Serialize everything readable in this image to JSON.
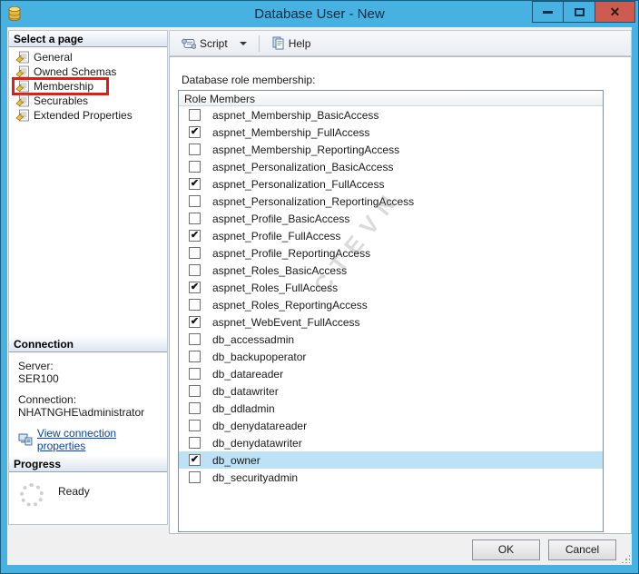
{
  "window": {
    "title": "Database User - New"
  },
  "icons": {
    "titlebar": "database-cylinder-icon",
    "close_glyph": "✕",
    "checkmark_glyph": "✔"
  },
  "sidebar": {
    "select_page_header": "Select a page",
    "pages": [
      {
        "label": "General",
        "annotated": false
      },
      {
        "label": "Owned Schemas",
        "annotated": false
      },
      {
        "label": "Membership",
        "annotated": true
      },
      {
        "label": "Securables",
        "annotated": false
      },
      {
        "label": "Extended Properties",
        "annotated": false
      }
    ],
    "connection_header": "Connection",
    "server_label": "Server:",
    "server_value": "SER100",
    "connection_label": "Connection:",
    "connection_value": "NHATNGHE\\administrator",
    "view_connection_link": "View connection properties",
    "progress_header": "Progress",
    "progress_status": "Ready"
  },
  "toolbar": {
    "script_label": "Script",
    "help_label": "Help"
  },
  "main": {
    "role_membership_label": "Database role membership:",
    "list_header": "Role Members",
    "watermark": "CTEVN",
    "roles": [
      {
        "name": "aspnet_Membership_BasicAccess",
        "checked": false,
        "annotated": false,
        "selected": false
      },
      {
        "name": "aspnet_Membership_FullAccess",
        "checked": true,
        "annotated": true,
        "selected": false
      },
      {
        "name": "aspnet_Membership_ReportingAccess",
        "checked": false,
        "annotated": false,
        "selected": false
      },
      {
        "name": "aspnet_Personalization_BasicAccess",
        "checked": false,
        "annotated": false,
        "selected": false
      },
      {
        "name": "aspnet_Personalization_FullAccess",
        "checked": true,
        "annotated": true,
        "selected": false
      },
      {
        "name": "aspnet_Personalization_ReportingAccess",
        "checked": false,
        "annotated": false,
        "selected": false
      },
      {
        "name": "aspnet_Profile_BasicAccess",
        "checked": false,
        "annotated": false,
        "selected": false
      },
      {
        "name": "aspnet_Profile_FullAccess",
        "checked": true,
        "annotated": true,
        "selected": false
      },
      {
        "name": "aspnet_Profile_ReportingAccess",
        "checked": false,
        "annotated": false,
        "selected": false
      },
      {
        "name": "aspnet_Roles_BasicAccess",
        "checked": false,
        "annotated": false,
        "selected": false
      },
      {
        "name": "aspnet_Roles_FullAccess",
        "checked": true,
        "annotated": true,
        "selected": false
      },
      {
        "name": "aspnet_Roles_ReportingAccess",
        "checked": false,
        "annotated": false,
        "selected": false
      },
      {
        "name": "aspnet_WebEvent_FullAccess",
        "checked": true,
        "annotated": true,
        "selected": false
      },
      {
        "name": "db_accessadmin",
        "checked": false,
        "annotated": false,
        "selected": false
      },
      {
        "name": "db_backupoperator",
        "checked": false,
        "annotated": false,
        "selected": false
      },
      {
        "name": "db_datareader",
        "checked": false,
        "annotated": false,
        "selected": false
      },
      {
        "name": "db_datawriter",
        "checked": false,
        "annotated": false,
        "selected": false
      },
      {
        "name": "db_ddladmin",
        "checked": false,
        "annotated": false,
        "selected": false
      },
      {
        "name": "db_denydatareader",
        "checked": false,
        "annotated": false,
        "selected": false
      },
      {
        "name": "db_denydatawriter",
        "checked": false,
        "annotated": false,
        "selected": false
      },
      {
        "name": "db_owner",
        "checked": true,
        "annotated": true,
        "selected": true
      },
      {
        "name": "db_securityadmin",
        "checked": false,
        "annotated": false,
        "selected": false
      }
    ]
  },
  "footer": {
    "ok_label": "OK",
    "cancel_label": "Cancel"
  },
  "colors": {
    "titlebar_blue": "#47b2e2",
    "close_red": "#ce5b50",
    "annotation_red": "#de1f18",
    "selection_blue": "#bde2f5",
    "link_blue": "#0645ad"
  }
}
